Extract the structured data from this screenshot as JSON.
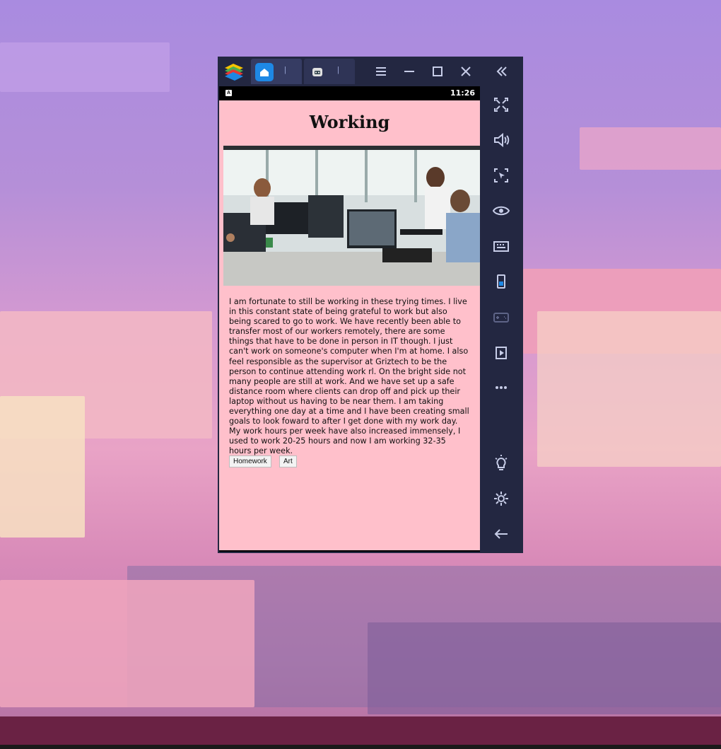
{
  "window": {
    "tabs": [
      {
        "label": "|"
      },
      {
        "label": "|"
      }
    ]
  },
  "statusbar": {
    "time": "11:26",
    "indicator": "A"
  },
  "page": {
    "title": "Working",
    "paragraph": "I am fortunate to still be working in these trying times. I live in this constant state of being grateful to work but also being scared to go to work. We have recently been able to transfer most of our workers remotely, there are some things that have to be done in person in IT though. I just can't work on someone's computer when I'm at home. I also feel responsible as the supervisor at Griztech to be the person to continue attending work rl. On the bright side not many people are still at work. And we have set up a safe distance room where clients can drop off and pick up their laptop without us having to be near them. I am taking everything one day at a time and I have been creating small goals to look foward to after I get done with my work day. My work hours per week have also increased immensely, I used to work 20-25 hours and now I am working 32-35 hours per week.",
    "buttons": {
      "homework": "Homework",
      "art": "Art"
    }
  },
  "colors": {
    "page_bg": "#ffc0cb",
    "window_bg": "#232741",
    "accent_blue": "#1e88e5"
  },
  "sidebar": {
    "icons": [
      "collapse-icon",
      "fullscreen-icon",
      "volume-icon",
      "screenshot-icon",
      "eye-icon",
      "keyboard-icon",
      "phone-rotate-icon",
      "gamepad-icon",
      "install-apk-icon",
      "more-icon",
      "lightbulb-icon",
      "settings-icon",
      "back-arrow-icon"
    ]
  }
}
